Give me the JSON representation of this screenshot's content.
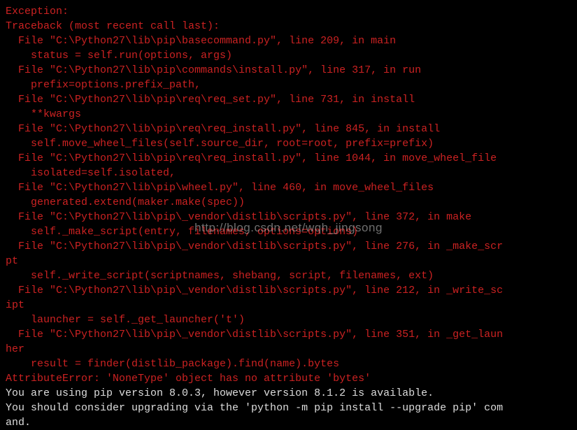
{
  "watermark": "http://blog.csdn.net/wqh_jingsong",
  "traceback": {
    "lines": [
      {
        "type": "error",
        "text": "Exception:"
      },
      {
        "type": "error",
        "text": "Traceback (most recent call last):"
      },
      {
        "type": "error",
        "text": "  File \"C:\\Python27\\lib\\pip\\basecommand.py\", line 209, in main"
      },
      {
        "type": "error",
        "text": "    status = self.run(options, args)"
      },
      {
        "type": "error",
        "text": "  File \"C:\\Python27\\lib\\pip\\commands\\install.py\", line 317, in run"
      },
      {
        "type": "error",
        "text": "    prefix=options.prefix_path,"
      },
      {
        "type": "error",
        "text": "  File \"C:\\Python27\\lib\\pip\\req\\req_set.py\", line 731, in install"
      },
      {
        "type": "error",
        "text": "    **kwargs"
      },
      {
        "type": "error",
        "text": "  File \"C:\\Python27\\lib\\pip\\req\\req_install.py\", line 845, in install"
      },
      {
        "type": "error",
        "text": "    self.move_wheel_files(self.source_dir, root=root, prefix=prefix)"
      },
      {
        "type": "error",
        "text": "  File \"C:\\Python27\\lib\\pip\\req\\req_install.py\", line 1044, in move_wheel_file"
      },
      {
        "type": "error",
        "text": "    isolated=self.isolated,"
      },
      {
        "type": "error",
        "text": "  File \"C:\\Python27\\lib\\pip\\wheel.py\", line 460, in move_wheel_files"
      },
      {
        "type": "error",
        "text": "    generated.extend(maker.make(spec))"
      },
      {
        "type": "error",
        "text": "  File \"C:\\Python27\\lib\\pip\\_vendor\\distlib\\scripts.py\", line 372, in make"
      },
      {
        "type": "error",
        "text": "    self._make_script(entry, filenames, options=options)"
      },
      {
        "type": "error",
        "text": "  File \"C:\\Python27\\lib\\pip\\_vendor\\distlib\\scripts.py\", line 276, in _make_scr"
      },
      {
        "type": "error",
        "text": "pt"
      },
      {
        "type": "error",
        "text": "    self._write_script(scriptnames, shebang, script, filenames, ext)"
      },
      {
        "type": "error",
        "text": "  File \"C:\\Python27\\lib\\pip\\_vendor\\distlib\\scripts.py\", line 212, in _write_sc"
      },
      {
        "type": "error",
        "text": "ipt"
      },
      {
        "type": "error",
        "text": "    launcher = self._get_launcher('t')"
      },
      {
        "type": "error",
        "text": "  File \"C:\\Python27\\lib\\pip\\_vendor\\distlib\\scripts.py\", line 351, in _get_laun"
      },
      {
        "type": "error",
        "text": "her"
      },
      {
        "type": "error",
        "text": "    result = finder(distlib_package).find(name).bytes"
      },
      {
        "type": "error",
        "text": "AttributeError: 'NoneType' object has no attribute 'bytes'"
      },
      {
        "type": "plain",
        "text": "You are using pip version 8.0.3, however version 8.1.2 is available."
      },
      {
        "type": "plain",
        "text": "You should consider upgrading via the 'python -m pip install --upgrade pip' com"
      },
      {
        "type": "plain",
        "text": "and."
      }
    ]
  }
}
